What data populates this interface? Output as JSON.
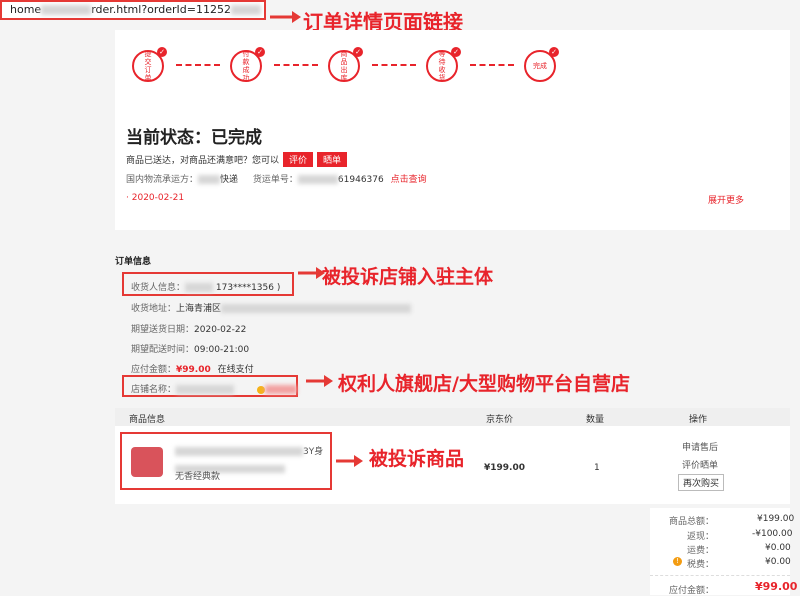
{
  "url": {
    "prefix": "home",
    "mid": "rder.html?orderId=11252"
  },
  "annotations": {
    "url_note": "订单详情页面链接",
    "store_owner_note": "被投诉店铺入驻主体",
    "store_name_note": "权利人旗舰店/大型购物平台自营店",
    "product_note": "被投诉商品"
  },
  "progress": {
    "steps": [
      {
        "label": "提交订单"
      },
      {
        "label": "付款成功"
      },
      {
        "label": "商品出库"
      },
      {
        "label": "等待收货"
      },
      {
        "label": "完成"
      }
    ],
    "check_glyph": "✓"
  },
  "status": {
    "title": "当前状态：已完成",
    "prompt": "商品已送达，对商品还满意吧？您可以",
    "review_btn": "评价",
    "share_btn": "晒单",
    "logistics_label": "国内物流承运方：",
    "carrier": "快递",
    "tracking_label": "货运单号：",
    "tracking_suffix": "61946376",
    "query_link": "点击查询",
    "date": "2020-02-21",
    "date_bullet": "·",
    "expand_link": "展开更多"
  },
  "order_info": {
    "section_title": "订单信息",
    "receiver_label": "收货人信息：",
    "receiver_phone": "173****1356 )",
    "address_label": "收货地址：",
    "address": "上海青浦区",
    "delivery_date_label": "期望送货日期：",
    "delivery_date": "2020-02-22",
    "delivery_time_label": "期望配送时间：",
    "delivery_time": "09:00-21:00",
    "payable_label": "应付金额：",
    "payable": "¥99.00",
    "pay_method": "在线支付",
    "store_label": "店铺名称："
  },
  "table": {
    "headers": [
      "商品信息",
      "京东价",
      "数量",
      "操作"
    ],
    "row": {
      "name_tail": "3Y身",
      "note": "无香经典款",
      "price": "¥199.00",
      "qty": "1",
      "action_aftersale": "申请售后",
      "action_review": "评价晒单",
      "action_rebuy": "再次购买"
    }
  },
  "summary": {
    "rows": [
      {
        "label": "商品总额：",
        "value": "¥199.00"
      },
      {
        "label": "返现：",
        "value": "-¥100.00"
      },
      {
        "label": "运费：",
        "value": "¥0.00"
      },
      {
        "label": "税费：",
        "value": "¥0.00"
      }
    ],
    "payable_label": "应付金额：",
    "payable_value": "¥99.00"
  },
  "colors": {
    "accent": "#e8242b",
    "annotation": "#e53935"
  }
}
